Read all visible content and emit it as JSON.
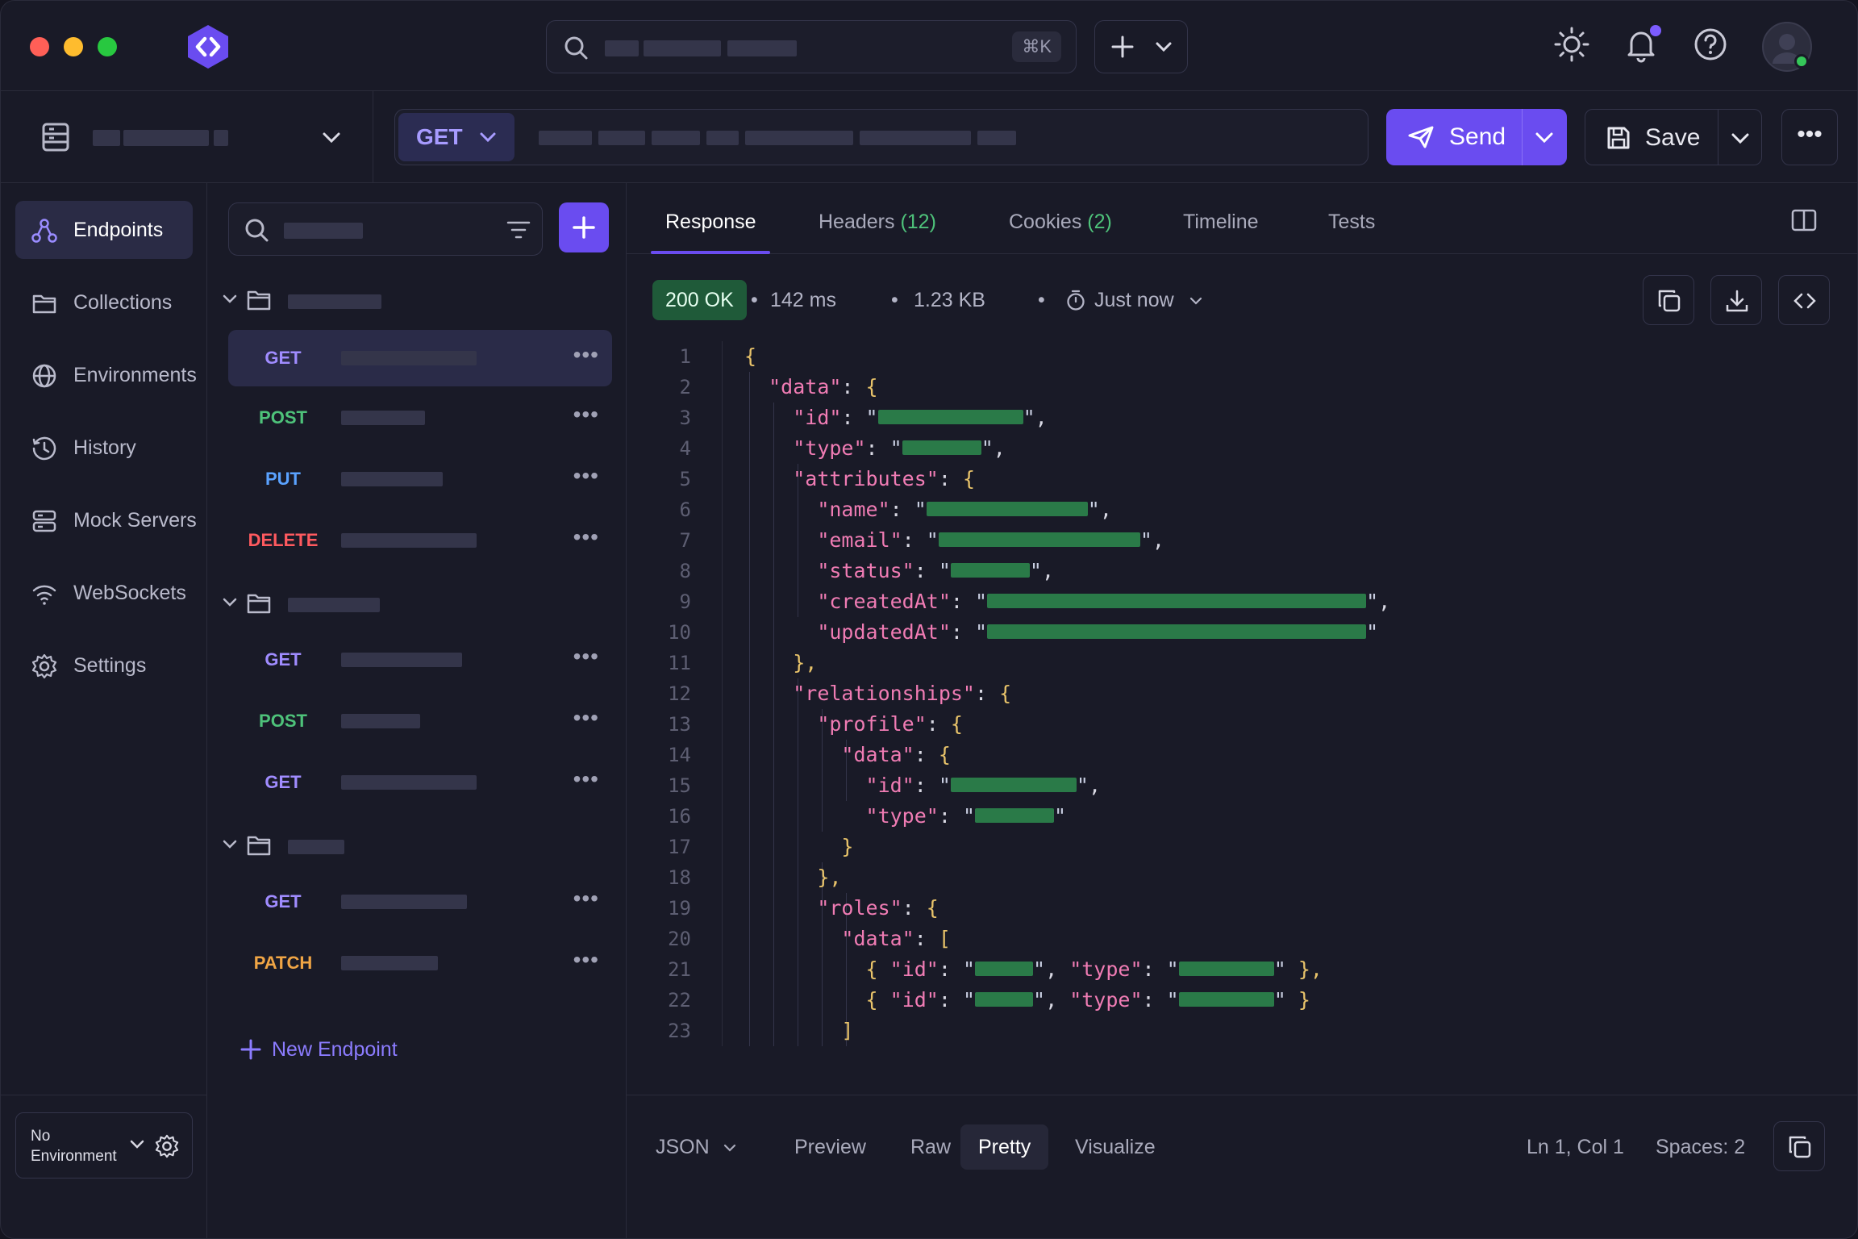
{
  "titlebar": {
    "search_shortcut": "⌘K",
    "icons": [
      "sun-icon",
      "bell-icon",
      "help-icon",
      "avatar"
    ]
  },
  "request": {
    "method": "GET",
    "send_label": "Send",
    "save_label": "Save",
    "more_label": "•••"
  },
  "nav": {
    "items": [
      {
        "label": "Endpoints",
        "icon": "endpoints-icon",
        "active": true
      },
      {
        "label": "Collections",
        "icon": "folder-icon"
      },
      {
        "label": "Environments",
        "icon": "globe-icon"
      },
      {
        "label": "History",
        "icon": "clock-icon"
      },
      {
        "label": "Mock Servers",
        "icon": "server-icon"
      },
      {
        "label": "WebSockets",
        "icon": "wifi-icon"
      },
      {
        "label": "Settings",
        "icon": "gear-icon"
      }
    ],
    "environment": "No Environment"
  },
  "tree": {
    "endpoints": [
      {
        "method": "GET"
      },
      {
        "method": "POST"
      },
      {
        "method": "PUT"
      },
      {
        "method": "DELETE"
      },
      {
        "method": "GET"
      },
      {
        "method": "POST"
      },
      {
        "method": "GET"
      },
      {
        "method": "GET"
      },
      {
        "method": "PATCH"
      }
    ],
    "dots": "•••",
    "new_endpoint": "New Endpoint"
  },
  "response": {
    "tabs": {
      "response": "Response",
      "headers": "Headers",
      "headers_count": "(12)",
      "cookies": "Cookies",
      "cookies_count": "(2)",
      "timeline": "Timeline",
      "tests": "Tests"
    },
    "status": "200 OK",
    "time": "142 ms",
    "size": "1.23 KB",
    "when": "Just now",
    "sep": "•",
    "line_numbers": [
      "1",
      "2",
      "3",
      "4",
      "5",
      "6",
      "7",
      "8",
      "9",
      "10",
      "11",
      "12",
      "13",
      "14",
      "15",
      "16",
      "17",
      "18",
      "19",
      "20",
      "21",
      "22",
      "23"
    ],
    "keys": {
      "data": "\"data\"",
      "id": "\"id\"",
      "type": "\"type\"",
      "attributes": "\"attributes\"",
      "name": "\"name\"",
      "email": "\"email\"",
      "status": "\"status\"",
      "createdAt": "\"createdAt\"",
      "updatedAt": "\"updatedAt\"",
      "relationships": "\"relationships\"",
      "profile": "\"profile\"",
      "roles": "\"roles\""
    },
    "format": {
      "json": "JSON",
      "preview": "Preview",
      "raw": "Raw",
      "pretty": "Pretty",
      "visualize": "Visualize",
      "cursor": "Ln 1, Col 1",
      "spaces": "Spaces: 2"
    }
  },
  "colors": {
    "accent": "#6a4cf0",
    "GET": "#a08cff",
    "POST": "#4ec27a",
    "PUT": "#5aa2ff",
    "DELETE": "#ff5a5f",
    "PATCH": "#f0a545"
  }
}
